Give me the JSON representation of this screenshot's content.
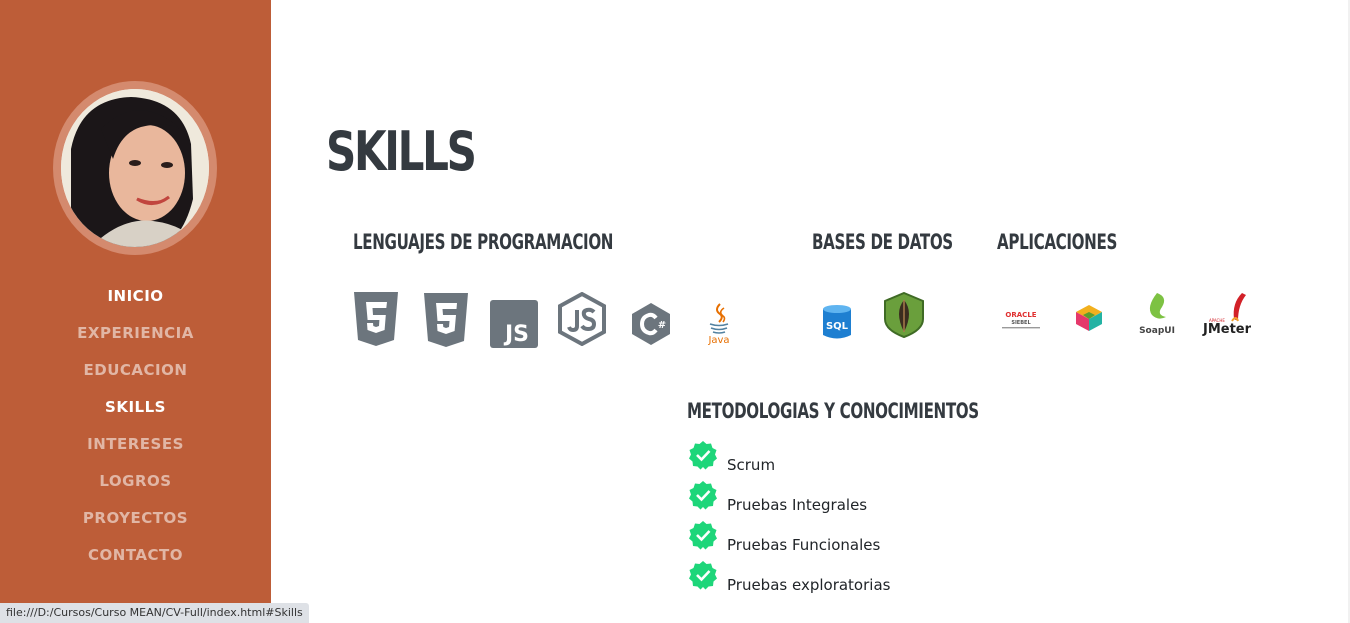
{
  "sidebar": {
    "nav": [
      {
        "label": "INICIO",
        "active": true
      },
      {
        "label": "EXPERIENCIA",
        "active": false
      },
      {
        "label": "EDUCACION",
        "active": false
      },
      {
        "label": "SKILLS",
        "active": true
      },
      {
        "label": "INTERESES",
        "active": false
      },
      {
        "label": "LOGROS",
        "active": false
      },
      {
        "label": "PROYECTOS",
        "active": false
      },
      {
        "label": "CONTACTO",
        "active": false
      }
    ]
  },
  "main": {
    "title": "SKILLS",
    "languages": {
      "title": "LENGUAJES DE PROGRAMACION",
      "icons": [
        "html5-icon",
        "css3-icon",
        "js-icon",
        "nodejs-icon",
        "csharp-icon",
        "java-icon"
      ],
      "java_label": "Java"
    },
    "databases": {
      "title": "BASES DE DATOS",
      "icons": [
        "sql-server-icon",
        "mongodb-icon"
      ],
      "sql_label": "SQL"
    },
    "apps": {
      "title": "APLICACIONES",
      "icons": [
        "oracle-siebel-icon",
        "multicolor-cube-icon",
        "soapui-icon",
        "jmeter-icon"
      ],
      "oracle_label": "ORACLE",
      "siebel_label": "SIEBEL",
      "soapui_label": "SoapUI",
      "apache_label": "APACHE",
      "jmeter_label": "JMeter"
    },
    "methods": {
      "title": "METODOLOGIAS Y CONOCIMIENTOS",
      "items": [
        "Scrum",
        "Pruebas Integrales",
        "Pruebas Funcionales",
        "Pruebas exploratorias"
      ]
    }
  },
  "status_bar": {
    "url": "file:///D:/Cursos/Curso MEAN/CV-Full/index.html#Skills"
  },
  "colors": {
    "sidebar": "#bd5d38",
    "heading": "#343a40",
    "icon_gray": "#6c757d",
    "check_green": "#1ed67a",
    "mongo_green": "#4fa940"
  }
}
